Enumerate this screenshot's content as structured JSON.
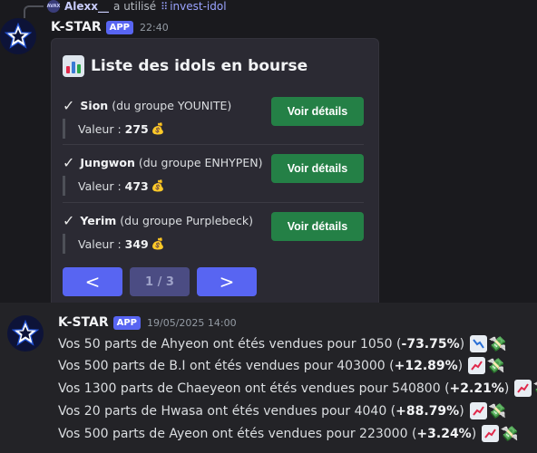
{
  "reply": {
    "avatar_text": "AVAX",
    "user": "Alexx__",
    "action": "a utilisé",
    "command_icon": "⠿",
    "command": "invest-idol"
  },
  "message1": {
    "username": "K-STAR",
    "badge": "APP",
    "time": "22:40",
    "embed": {
      "title": "Liste des idols en bourse",
      "title_icon": "bar-chart-icon",
      "idols": [
        {
          "check": "✓",
          "name": "Sion",
          "group": "(du groupe YOUNITE)",
          "value_label": "Valeur :",
          "value": "275",
          "bag": "💰",
          "button": "Voir détails"
        },
        {
          "check": "✓",
          "name": "Jungwon",
          "group": "(du groupe ENHYPEN)",
          "value_label": "Valeur :",
          "value": "473",
          "bag": "💰",
          "button": "Voir détails"
        },
        {
          "check": "✓",
          "name": "Yerim",
          "group": "(du groupe Purplebeck)",
          "value_label": "Valeur :",
          "value": "349",
          "bag": "💰",
          "button": "Voir détails"
        }
      ],
      "pager": {
        "prev": "<",
        "page": "1 / 3",
        "next": ">"
      }
    }
  },
  "message2": {
    "username": "K-STAR",
    "badge": "APP",
    "time": "19/05/2025 14:00",
    "sales": [
      {
        "text": "Vos 50 parts de Ahyeon ont étés vendues pour 1050 (",
        "pct": "-73.75%",
        "close": ")",
        "trend": "down"
      },
      {
        "text": "Vos 500 parts de B.I ont étés vendues pour 403000 (",
        "pct": "+12.89%",
        "close": ")",
        "trend": "up"
      },
      {
        "text": "Vos 1300 parts de Chaeyeon ont étés vendues pour 540800 (",
        "pct": "+2.21%",
        "close": ")",
        "trend": "up"
      },
      {
        "text": "Vos 20 parts de Hwasa ont étés vendues pour 4040 (",
        "pct": "+88.79%",
        "close": ")",
        "trend": "up"
      },
      {
        "text": "Vos 500 parts de Ayeon ont étés vendues pour 223000 (",
        "pct": "+3.24%",
        "close": ")",
        "trend": "up"
      }
    ],
    "money_emoji": "💸"
  },
  "colors": {
    "accent": "#5865f2",
    "success_button": "#248046",
    "trend_up": "#e0284a",
    "trend_down": "#2a6fd6"
  }
}
